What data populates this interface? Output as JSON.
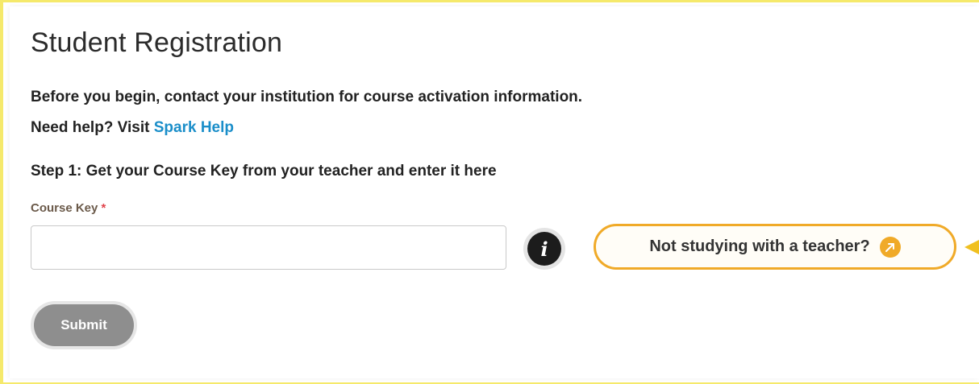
{
  "page": {
    "title": "Student Registration",
    "intro": "Before you begin, contact your institution for course activation information.",
    "help_prefix": "Need help? Visit ",
    "help_link": "Spark Help",
    "step1": "Step 1: Get your Course Key from your teacher and enter it here"
  },
  "form": {
    "course_key_label": "Course Key",
    "required_marker": "*",
    "course_key_value": "",
    "info_icon": "i",
    "submit_label": "Submit"
  },
  "teacher_prompt": {
    "label": "Not studying with a teacher?",
    "icon": "external-arrow-icon"
  },
  "colors": {
    "accent": "#f0aa28",
    "link": "#1a8ec9",
    "required": "#e0434b",
    "submit_bg": "#8e8e8e",
    "highlight_border": "#f5e96b"
  }
}
